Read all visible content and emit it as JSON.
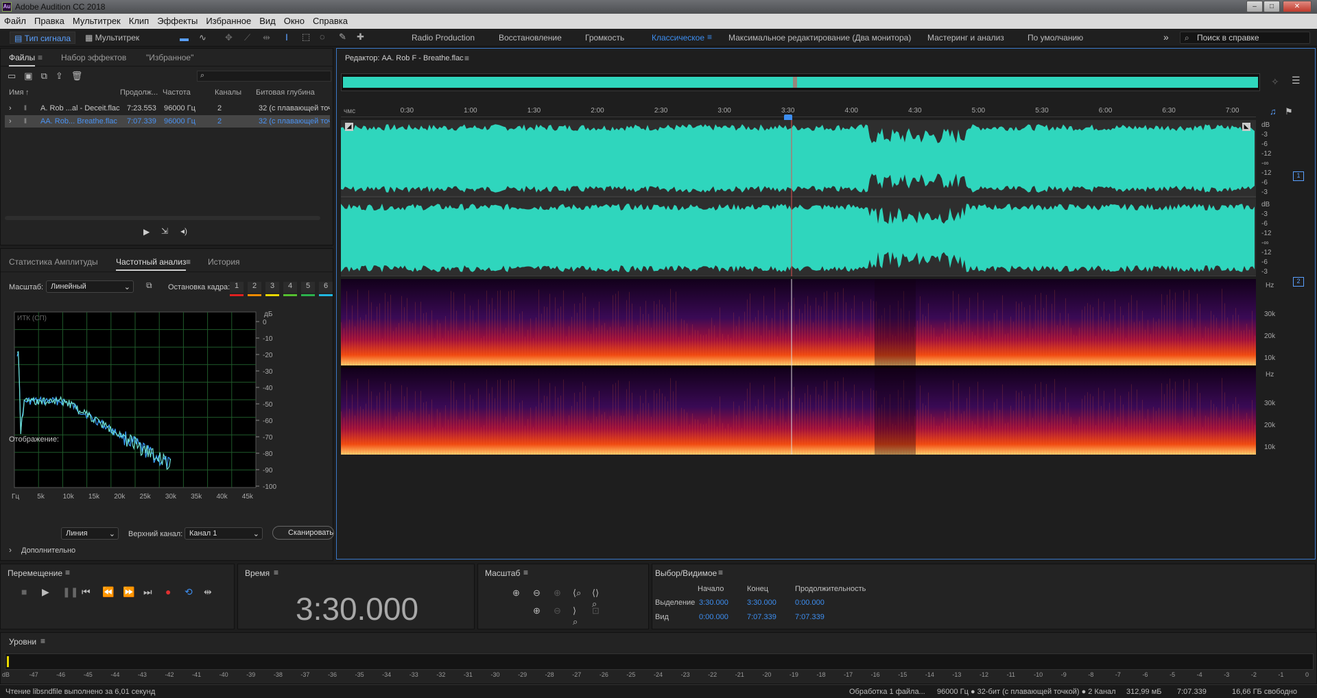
{
  "app": {
    "title": "Adobe Audition CC 2018",
    "icon": "Au"
  },
  "menu": [
    "Файл",
    "Правка",
    "Мультитрек",
    "Клип",
    "Эффекты",
    "Избранное",
    "Вид",
    "Окно",
    "Справка"
  ],
  "toolbar": {
    "waveform_label": "Тип сигнала",
    "multitrack_label": "Мультитрек"
  },
  "workspaces": [
    "Radio Production",
    "Восстановление",
    "Громкость",
    "Классическое",
    "Максимальное редактирование (Два монитора)",
    "Мастеринг и анализ",
    "По умолчанию"
  ],
  "active_workspace": "Классическое",
  "search": {
    "placeholder": "Поиск в справке"
  },
  "files_panel": {
    "tabs": [
      "Файлы",
      "Набор эффектов",
      "\"Избранное\""
    ],
    "columns": [
      "Имя",
      "Продолж...",
      "Частота",
      "Каналы",
      "Битовая глубина"
    ],
    "rows": [
      {
        "name": "A. Rob ...al - Deceit.flac",
        "duration": "7:23.553",
        "rate": "96000 Гц",
        "channels": "2",
        "depth": "32 (с плавающей точ"
      },
      {
        "name": "AA. Rob... Breathe.flac",
        "duration": "7:07.339",
        "rate": "96000 Гц",
        "channels": "2",
        "depth": "32 (с плавающей точ"
      }
    ]
  },
  "analysis_panel": {
    "tabs": [
      "Статистика Амплитуды",
      "Частотный анализ",
      "История"
    ],
    "scale_label": "Масштаб:",
    "scale_value": "Линейный",
    "freeze_label": "Остановка кадра:",
    "freeze_slots": [
      "1",
      "2",
      "3",
      "4",
      "5",
      "6"
    ],
    "freeze_colors": [
      "#e02020",
      "#f08a00",
      "#e8d800",
      "#55c030",
      "#2bb24c",
      "#20b8e0"
    ],
    "graph_label": "ИТК (СП)",
    "db_unit": "дБ",
    "db_ticks": [
      "0",
      "-10",
      "-20",
      "-30",
      "-40",
      "-50",
      "-60",
      "-70",
      "-80",
      "-90",
      "-100"
    ],
    "freq_ticks": [
      "Гц",
      "5k",
      "10k",
      "15k",
      "20k",
      "25k",
      "30k",
      "35k",
      "40k",
      "45k"
    ],
    "display_label": "Отображение:",
    "display_value": "Линия",
    "top_channel_label": "Верхний канал:",
    "top_channel_value": "Канал 1",
    "scan_button": "Сканировать",
    "advanced_label": "Дополнительно"
  },
  "editor": {
    "title": "Редактор: AA. Rob F - Breathe.flac",
    "ruler_unit": "чмс",
    "ruler_ticks": [
      "0:30",
      "1:00",
      "1:30",
      "2:00",
      "2:30",
      "3:00",
      "3:30",
      "4:00",
      "4:30",
      "5:00",
      "5:30",
      "6:00",
      "6:30",
      "7:00"
    ],
    "db_ticks_ch": [
      "dB",
      "-3",
      "-6",
      "-12",
      "-∞",
      "-12",
      "-6",
      "-3"
    ],
    "channel_1": "1",
    "channel_2": "2",
    "spec_ticks": [
      "Hz",
      "30k",
      "20k",
      "10k"
    ],
    "playhead_time": "3:30.000"
  },
  "transport": {
    "title": "Перемещение"
  },
  "time": {
    "title": "Время",
    "value": "3:30.000"
  },
  "zoom": {
    "title": "Масштаб"
  },
  "selection": {
    "title": "Выбор/Видимое",
    "headers": [
      "Начало",
      "Конец",
      "Продолжительность"
    ],
    "selection_label": "Выделение",
    "selection_start": "3:30.000",
    "selection_end": "3:30.000",
    "selection_duration": "0:00.000",
    "view_label": "Вид",
    "view_start": "0:00.000",
    "view_end": "7:07.339",
    "view_duration": "7:07.339"
  },
  "levels": {
    "title": "Уровни",
    "ticks": [
      "dB",
      "-47",
      "-46",
      "-45",
      "-44",
      "-43",
      "-42",
      "-41",
      "-40",
      "-39",
      "-38",
      "-37",
      "-36",
      "-35",
      "-34",
      "-33",
      "-32",
      "-31",
      "-30",
      "-29",
      "-28",
      "-27",
      "-26",
      "-25",
      "-24",
      "-23",
      "-22",
      "-21",
      "-20",
      "-19",
      "-18",
      "-17",
      "-16",
      "-15",
      "-14",
      "-13",
      "-12",
      "-11",
      "-10",
      "-9",
      "-8",
      "-7",
      "-6",
      "-5",
      "-4",
      "-3",
      "-2",
      "-1",
      "0"
    ]
  },
  "status": {
    "left": "Чтение libsndfile выполнено за 6,01 секунд",
    "processing": "Обработка 1 файла...",
    "format": "96000 Гц ● 32-бит (с плавающей точкой) ● 2 Канал",
    "size": "312,99 мБ",
    "duration": "7:07.339",
    "free": "16,66 ГБ свободно"
  },
  "colors": {
    "waveform": "#2fd6bd",
    "accent": "#3d8ef0",
    "playhead": "#e05050"
  }
}
